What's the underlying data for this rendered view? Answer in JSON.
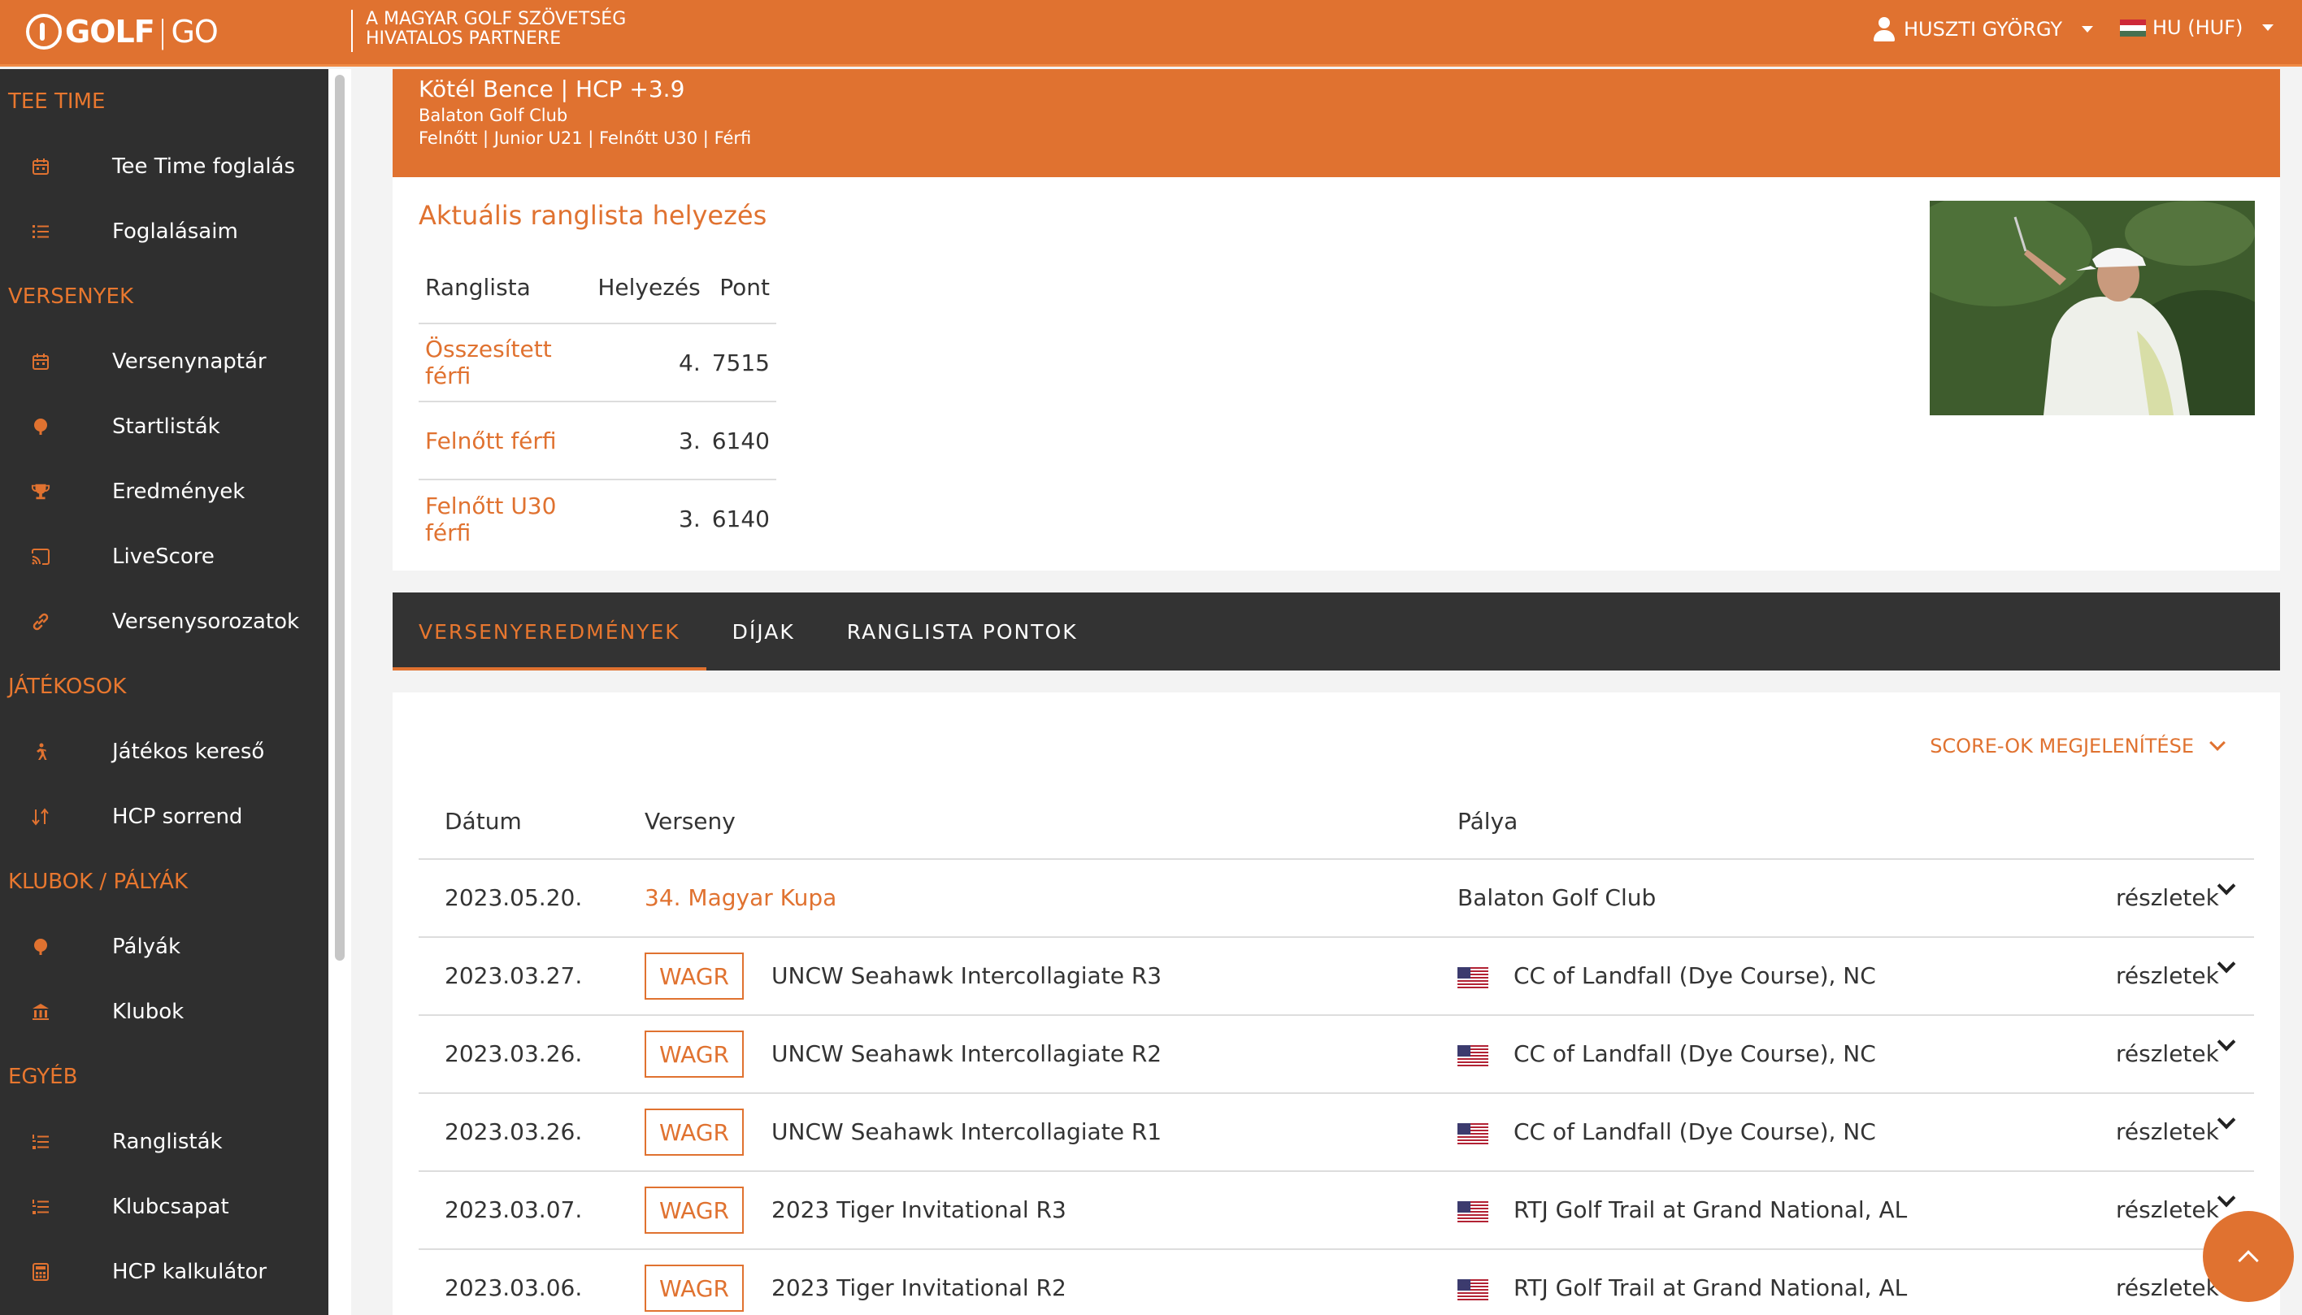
{
  "header": {
    "logo_bold": "GOLF",
    "logo_sep": "|",
    "logo_light": "GO",
    "partner_line1": "A MAGYAR GOLF SZÖVETSÉG",
    "partner_line2": "HIVATALOS PARTNERE",
    "user_name": "HUSZTI GYÖRGY",
    "language": "HU (HUF)"
  },
  "sidebar": {
    "sections": [
      {
        "title": "TEE TIME",
        "items": [
          {
            "label": "Tee Time foglalás",
            "icon": "calendar-icon"
          },
          {
            "label": "Foglalásaim",
            "icon": "list-icon"
          }
        ]
      },
      {
        "title": "VERSENYEK",
        "items": [
          {
            "label": "Versenynaptár",
            "icon": "calendar-icon"
          },
          {
            "label": "Startlisták",
            "icon": "golf-ball-icon"
          },
          {
            "label": "Eredmények",
            "icon": "trophy-icon"
          },
          {
            "label": "LiveScore",
            "icon": "cast-icon"
          },
          {
            "label": "Versenysorozatok",
            "icon": "link-icon"
          }
        ]
      },
      {
        "title": "JÁTÉKOSOK",
        "items": [
          {
            "label": "Játékos kereső",
            "icon": "player-icon"
          },
          {
            "label": "HCP sorrend",
            "icon": "sort-icon"
          }
        ]
      },
      {
        "title": "KLUBOK / PÁLYÁK",
        "items": [
          {
            "label": "Pályák",
            "icon": "golf-ball-icon"
          },
          {
            "label": "Klubok",
            "icon": "building-icon"
          }
        ]
      },
      {
        "title": "EGYÉB",
        "items": [
          {
            "label": "Ranglisták",
            "icon": "ranked-list-icon"
          },
          {
            "label": "Klubcsapat",
            "icon": "ranked-list-icon"
          },
          {
            "label": "HCP kalkulátor",
            "icon": "calculator-icon"
          }
        ]
      }
    ]
  },
  "player": {
    "name_hcp": "Kötél Bence | HCP +3.9",
    "club": "Balaton Golf Club",
    "categories": "Felnőtt | Junior U21 | Felnőtt U30 | Férfi"
  },
  "ranking": {
    "title": "Aktuális ranglista helyezés",
    "headers": [
      "Ranglista",
      "Helyezés",
      "Pont"
    ],
    "rows": [
      {
        "name": "Összesített férfi",
        "position": "4.",
        "points": "7515"
      },
      {
        "name": "Felnőtt férfi",
        "position": "3.",
        "points": "6140"
      },
      {
        "name": "Felnőtt U30 férfi",
        "position": "3.",
        "points": "6140"
      }
    ]
  },
  "tabs": [
    "VERSENYEREDMÉNYEK",
    "DÍJAK",
    "RANGLISTA PONTOK"
  ],
  "results": {
    "score_toggle": "SCORE-OK MEGJELENÍTÉSE",
    "headers": [
      "Dátum",
      "Verseny",
      "Pálya"
    ],
    "rows": [
      {
        "date": "2023.05.20.",
        "badge": "",
        "competition": "34. Magyar Kupa",
        "course": "Balaton Golf Club",
        "details": "részletek"
      },
      {
        "date": "2023.03.27.",
        "badge": "WAGR",
        "competition": "UNCW Seahawk Intercollagiate R3",
        "course": "CC of Landfall (Dye Course), NC",
        "details": "részletek"
      },
      {
        "date": "2023.03.26.",
        "badge": "WAGR",
        "competition": "UNCW Seahawk Intercollagiate R2",
        "course": "CC of Landfall (Dye Course), NC",
        "details": "részletek"
      },
      {
        "date": "2023.03.26.",
        "badge": "WAGR",
        "competition": "UNCW Seahawk Intercollagiate R1",
        "course": "CC of Landfall (Dye Course), NC",
        "details": "részletek"
      },
      {
        "date": "2023.03.07.",
        "badge": "WAGR",
        "competition": "2023 Tiger Invitational R3",
        "course": "RTJ Golf Trail at Grand National, AL",
        "details": "részletek"
      },
      {
        "date": "2023.03.06.",
        "badge": "WAGR",
        "competition": "2023 Tiger Invitational R2",
        "course": "RTJ Golf Trail at Grand National, AL",
        "details": "részletek"
      }
    ]
  },
  "colors": {
    "accent": "#e07230",
    "dark": "#2f2f2f"
  }
}
